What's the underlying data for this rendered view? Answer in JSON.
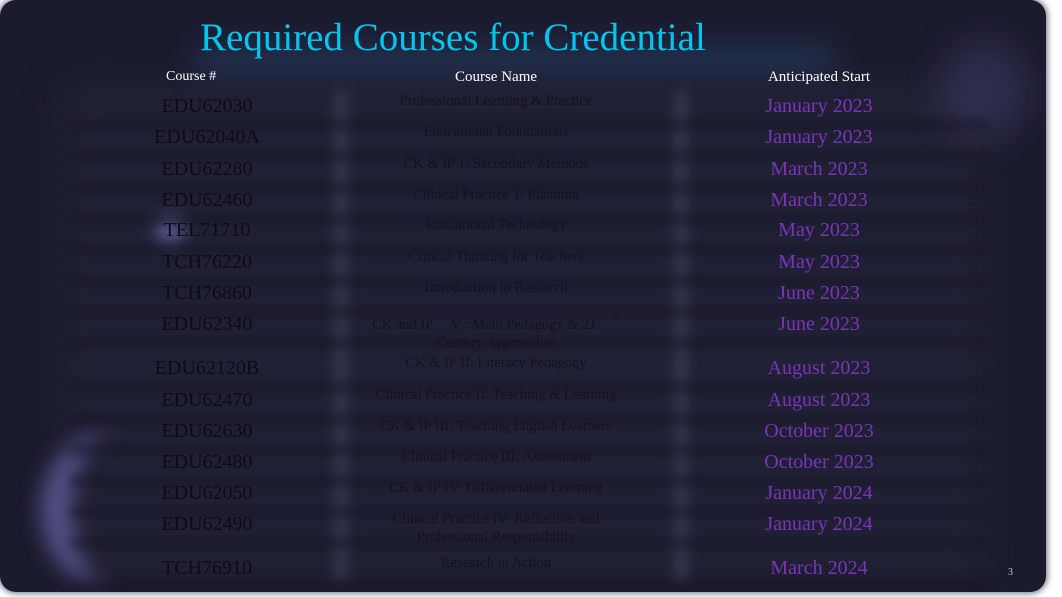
{
  "slide": {
    "title": "Required Courses for Credential",
    "page_number": "3",
    "colors": {
      "title": "#00c6ef",
      "date": "#7a34b8",
      "header": "#ffffff",
      "background": "#1b1b2e"
    }
  },
  "table": {
    "headers": {
      "code": "Course #",
      "name": "Course Name",
      "start": "Anticipated Start"
    },
    "rows": [
      {
        "code": "EDU62030",
        "name": "Professional Learning & Practice",
        "start": "January 2023"
      },
      {
        "code": "EDU62040A",
        "name": "Educational Foundations",
        "start": "January 2023"
      },
      {
        "code": "EDU62280",
        "name": "CK & IP 1: Secondary Methods",
        "start": "March 2023"
      },
      {
        "code": "EDU62460",
        "name": "Clinical Practice 1: Planning",
        "start": "March 2023"
      },
      {
        "code": "TEL71710",
        "name": "Educational Technology",
        "start": "May 2023"
      },
      {
        "code": "TCH76220",
        "name": "Critical Thinking for Teachers",
        "start": "May 2023"
      },
      {
        "code": "TCH76860",
        "name": "Introduction to Research",
        "start": "June 2023"
      },
      {
        "code": "EDU62340",
        "name": "CK and IP     V : Math Pedagogy & 21",
        "name_sup": "st",
        "name_line2": "Century Approaches",
        "start": "June 2023"
      },
      {
        "code": "EDU62120B",
        "name": "CK & IP II: Literacy Pedagogy",
        "start": "August 2023"
      },
      {
        "code": "EDU62470",
        "name": "Clinical Practice II: Teaching & Learning",
        "start": "August 2023"
      },
      {
        "code": "EDU62630",
        "name": "CK & IP III: Teaching English Learners",
        "start": "October 2023"
      },
      {
        "code": "EDU62480",
        "name": "Clinical Practice III: Assessment",
        "start": "October 2023"
      },
      {
        "code": "EDU62050",
        "name": "CK & IP IV: Differentiated Learning",
        "start": "January 2024"
      },
      {
        "code": "EDU62490",
        "name": "Clinical Practice IV: Reflection and",
        "name_line2": "Professional Responsibility",
        "start": "January 2024"
      },
      {
        "code": "TCH76910",
        "name": "Research in Action",
        "start": "March 2024"
      }
    ]
  }
}
